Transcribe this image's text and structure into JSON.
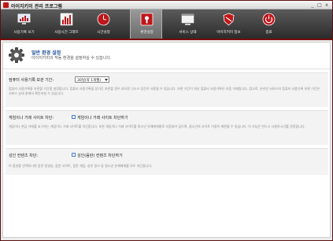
{
  "window": {
    "title": "아이지키미 관리 프로그램",
    "minimize": "_",
    "maximize": "□",
    "close": "x"
  },
  "toolbar": {
    "items": [
      {
        "label": "사용기록 보기",
        "icon": "monitor-chart-icon"
      },
      {
        "label": "사용시간 그래프",
        "icon": "bar-graph-icon"
      },
      {
        "label": "시간설정",
        "icon": "clock-icon"
      },
      {
        "label": "환경설정",
        "icon": "settings-safe-icon",
        "active": true
      },
      {
        "label": "서비스 상태",
        "icon": "service-window-icon"
      },
      {
        "label": "아이지키미 정보",
        "icon": "shield-icon"
      },
      {
        "label": "종료",
        "icon": "power-icon"
      }
    ]
  },
  "header": {
    "title": "일반 환경 설정",
    "subtitle": "아이지키미의 작동 환경을 설정하실 수 있습니다."
  },
  "retention": {
    "label": "컴퓨터 사용기록 보관 기간:",
    "value": "30일(약 1개월)",
    "description": "컴퓨터 사용기록을 보관할 기간을 설정합니다. 컴퓨터 사용기록을 장기간 보관할 경우 과도한 디스크 공간이 사용될 수 있습니다. 보관 기간이 지난 컴퓨터 사용기록은 자동 삭제됩니다. 참고로, 온라인 서비스의 컴퓨터 사용기록 보관 기간은 서비스 상태 창에서 확인하실 수 있습니다."
  },
  "game_block": {
    "label": "게임이나 거래 사이트 차단:",
    "checkbox_label": "게임이나 거래 사이트 차단하기",
    "description": "게임이나 현금 거래를 요구하는 게임이나 거래 사이트를 차단합니다. 또한 게임이나 거래 사이트를 청소년 유해매체물로 지정되어 있으며, 청소년의 사이트 이용이 제한될 수 있습니다. 이 기능은 반드시 사용하시기를 권장합니다."
  },
  "adult_block": {
    "label": "성인 컨텐츠 차단:",
    "checkbox_label": "성인(음란) 컨텐츠 차단하기",
    "description": "이 옵션을 선택하시면 음란 동영상, 음란 사이트, 음란 게임, 성인 광고 등 청소년 유해매체를 모두 차단합니다."
  },
  "colors": {
    "toolbar_bg": "#3a3a3a",
    "accent_red": "#c0161a",
    "title_blue": "#1d4f9c"
  }
}
